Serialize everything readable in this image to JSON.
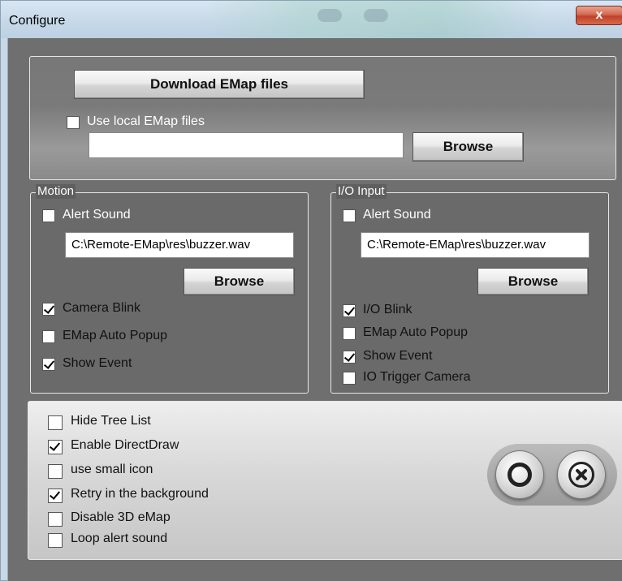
{
  "window": {
    "title": "Configure",
    "close_label": "x"
  },
  "top": {
    "download_label": "Download EMap files",
    "use_local_label": "Use local EMap files",
    "use_local_checked": false,
    "path_value": "",
    "browse_label": "Browse"
  },
  "motion": {
    "title": "Motion",
    "alert_sound_label": "Alert Sound",
    "alert_sound_checked": false,
    "sound_path": "C:\\Remote-EMap\\res\\buzzer.wav",
    "browse_label": "Browse",
    "camera_blink_label": "Camera Blink",
    "camera_blink_checked": true,
    "emap_auto_popup_label": "EMap Auto Popup",
    "emap_auto_popup_checked": false,
    "show_event_label": "Show Event",
    "show_event_checked": true
  },
  "io_input": {
    "title": "I/O Input",
    "alert_sound_label": "Alert Sound",
    "alert_sound_checked": false,
    "sound_path": "C:\\Remote-EMap\\res\\buzzer.wav",
    "browse_label": "Browse",
    "io_blink_label": "I/O Blink",
    "io_blink_checked": true,
    "emap_auto_popup_label": "EMap Auto Popup",
    "emap_auto_popup_checked": false,
    "show_event_label": "Show Event",
    "show_event_checked": true,
    "io_trigger_camera_label": "IO Trigger Camera",
    "io_trigger_camera_checked": false
  },
  "options": {
    "hide_tree_list_label": "Hide Tree List",
    "hide_tree_list_checked": false,
    "enable_directdraw_label": "Enable DirectDraw",
    "enable_directdraw_checked": true,
    "use_small_icon_label": "use small icon",
    "use_small_icon_checked": false,
    "retry_background_label": "Retry in the background",
    "retry_background_checked": true,
    "disable_3d_emap_label": "Disable 3D eMap",
    "disable_3d_emap_checked": false,
    "loop_alert_sound_label": "Loop alert sound",
    "loop_alert_sound_checked": false
  },
  "icons": {
    "ok": "ok-circle-icon",
    "cancel": "cancel-x-icon"
  }
}
